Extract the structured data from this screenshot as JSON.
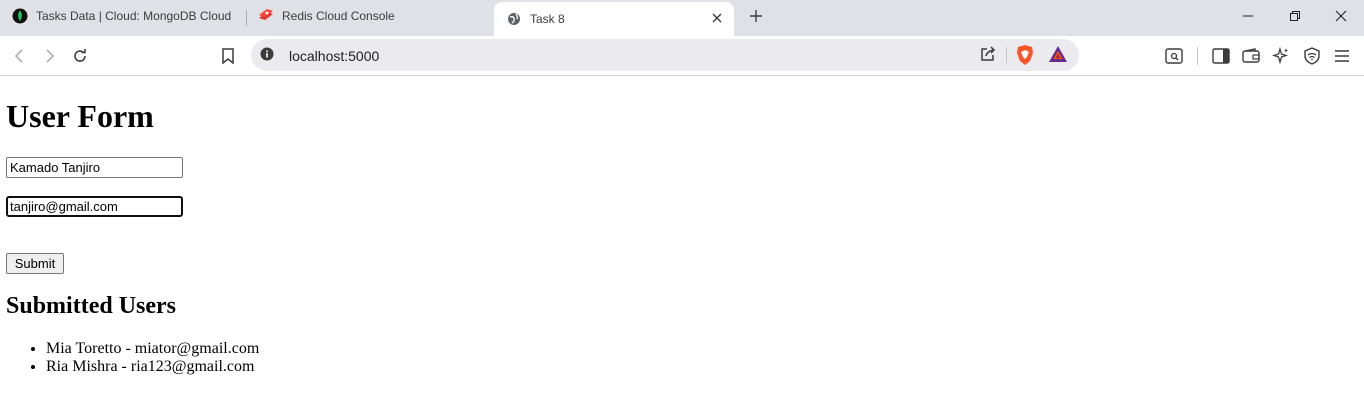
{
  "browser": {
    "tabs": [
      {
        "title": "Tasks Data | Cloud: MongoDB Cloud",
        "icon": "mongodb-leaf-icon"
      },
      {
        "title": "Redis Cloud Console",
        "icon": "redis-icon"
      },
      {
        "title": "Task 8",
        "icon": "globe-icon",
        "active": true
      }
    ],
    "address": "localhost:5000"
  },
  "page": {
    "heading": "User Form",
    "name_value": "Kamado Tanjiro",
    "email_value": "tanjiro@gmail.com",
    "submit_label": "Submit",
    "users_heading": "Submitted Users",
    "users": [
      "Mia Toretto - miator@gmail.com",
      "Ria Mishra - ria123@gmail.com"
    ]
  },
  "colors": {
    "tabstrip": "#dfe1e6",
    "omnibox": "#ebebef",
    "brave_orange": "#fb542b"
  }
}
